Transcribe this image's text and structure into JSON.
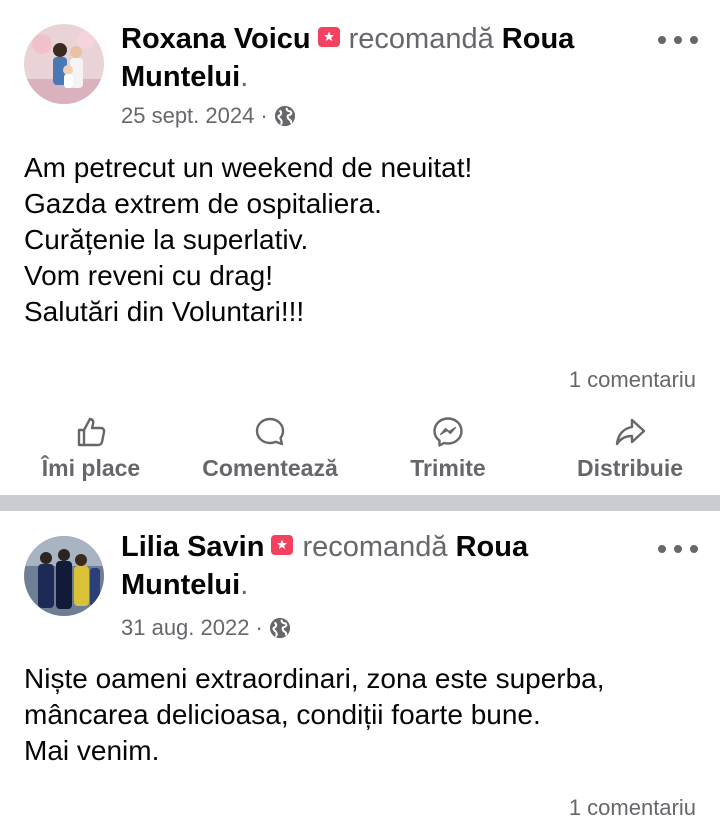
{
  "posts": [
    {
      "author": "Roxana Voicu",
      "verb": "recomandă",
      "page": "Roua Muntelui",
      "page_line1": "Roua",
      "page_line2": "Muntelui",
      "end_dot": ".",
      "date": "25 sept. 2024",
      "separator": "·",
      "body": [
        "Am petrecut un weekend de neuitat!",
        "Gazda extrem de ospitaliera.",
        "Curățenie la superlativ.",
        "Vom reveni cu drag!",
        "Salutări din Voluntari!!!"
      ],
      "comments": "1 comentariu"
    },
    {
      "author": "Lilia Savin",
      "verb": "recomandă",
      "page": "Roua Muntelui",
      "page_line1": "Roua",
      "page_line2": "Muntelui",
      "end_dot": ".",
      "date": "31 aug. 2022",
      "separator": "·",
      "body": [
        "Niște oameni extraordinari, zona este superba,",
        "mâncarea delicioasa, condiții foarte bune.",
        "Mai venim."
      ],
      "comments": "1 comentariu"
    }
  ],
  "actions": {
    "like": "Îmi place",
    "comment": "Comentează",
    "send": "Trimite",
    "share": "Distribuie"
  },
  "icons": {
    "recommend": "recommend-icon",
    "globe": "globe-icon",
    "more": "more-options-icon",
    "like": "thumbs-up-icon",
    "comment": "comment-bubble-icon",
    "send": "messenger-icon",
    "share": "share-arrow-icon"
  },
  "colors": {
    "recommend_red": "#f3425f",
    "secondary_text": "#65676b",
    "separator": "#c9ccd1"
  }
}
